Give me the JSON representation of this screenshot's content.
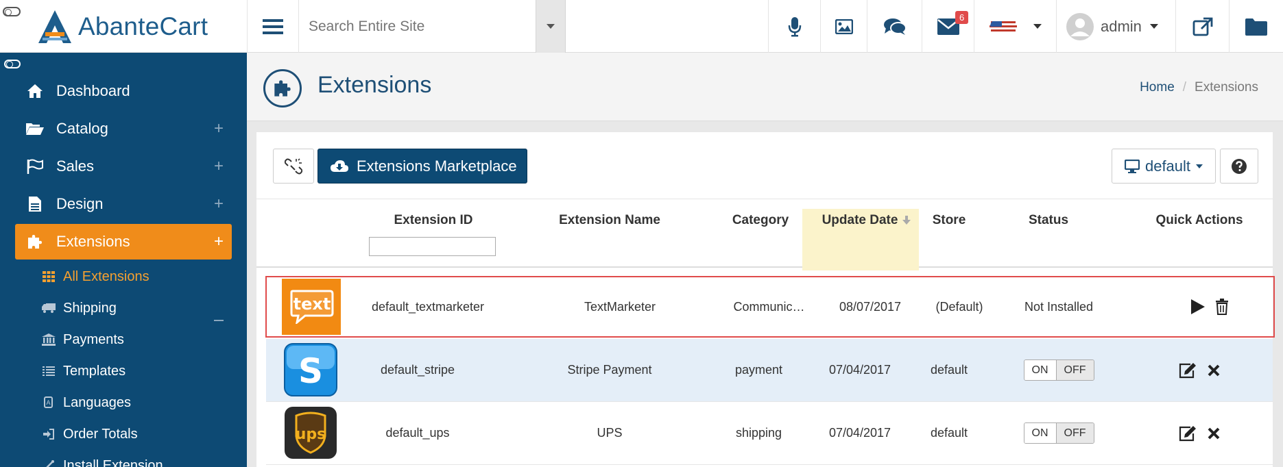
{
  "header": {
    "logo_text": "AbanteCart",
    "search_placeholder": "Search Entire Site",
    "mail_badge": "6",
    "user_name": "admin"
  },
  "sidebar": {
    "items": [
      {
        "label": "Dashboard",
        "icon": "home-icon"
      },
      {
        "label": "Catalog",
        "icon": "folder-open-icon"
      },
      {
        "label": "Sales",
        "icon": "flag-icon"
      },
      {
        "label": "Design",
        "icon": "file-icon"
      },
      {
        "label": "Extensions",
        "icon": "puzzle-icon"
      }
    ],
    "sub_items": [
      {
        "label": "All Extensions",
        "icon": "grid-icon"
      },
      {
        "label": "Shipping",
        "icon": "truck-icon"
      },
      {
        "label": "Payments",
        "icon": "bank-icon"
      },
      {
        "label": "Templates",
        "icon": "list-icon"
      },
      {
        "label": "Languages",
        "icon": "language-icon"
      },
      {
        "label": "Order Totals",
        "icon": "sign-in-icon"
      },
      {
        "label": "Install Extension",
        "icon": "magic-icon"
      }
    ]
  },
  "page": {
    "title": "Extensions",
    "breadcrumb": [
      "Home",
      "/",
      "Extensions"
    ]
  },
  "toolbar": {
    "marketplace_label": "Extensions Marketplace",
    "store_selector": "default"
  },
  "table": {
    "columns": [
      "Extension ID",
      "Extension Name",
      "Category",
      "Update Date",
      "Store",
      "Status",
      "Quick Actions"
    ],
    "rows": [
      {
        "id": "default_textmarketer",
        "name": "TextMarketer",
        "category": "Communic…",
        "date": "08/07/2017",
        "store": "(Default)",
        "status": "Not Installed",
        "thumb_text": "text"
      },
      {
        "id": "default_stripe",
        "name": "Stripe Payment",
        "category": "payment",
        "date": "07/04/2017",
        "store": "default",
        "status_on": "ON",
        "status_off": "OFF",
        "thumb_text": "S"
      },
      {
        "id": "default_ups",
        "name": "UPS",
        "category": "shipping",
        "date": "07/04/2017",
        "store": "default",
        "status_on": "ON",
        "status_off": "OFF",
        "thumb_text": "ups"
      }
    ]
  },
  "colors": {
    "sidebar_bg": "#0d4a74",
    "accent_orange": "#f08c1a",
    "brand_blue": "#1e5d8c",
    "highlight_row_border": "#e04b4b",
    "sorted_column_bg": "#fbf3cb"
  }
}
